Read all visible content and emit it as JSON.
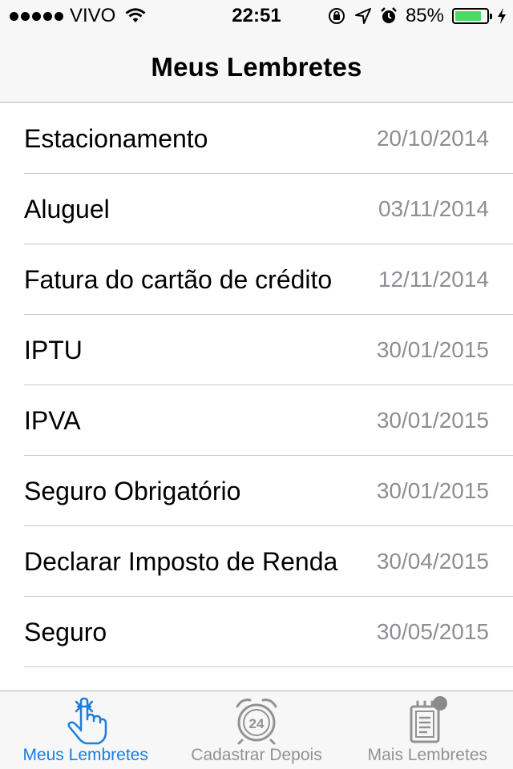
{
  "status_bar": {
    "carrier": "VIVO",
    "time": "22:51",
    "battery_percent": "85%",
    "battery_level": 0.85,
    "battery_color": "#4cd964"
  },
  "nav": {
    "title": "Meus Lembretes"
  },
  "reminders": [
    {
      "title": "Estacionamento",
      "date": "20/10/2014"
    },
    {
      "title": "Aluguel",
      "date": "03/11/2014"
    },
    {
      "title": "Fatura do cartão de crédito",
      "date": "12/11/2014"
    },
    {
      "title": "IPTU",
      "date": "30/01/2015"
    },
    {
      "title": "IPVA",
      "date": "30/01/2015"
    },
    {
      "title": "Seguro Obrigatório",
      "date": "30/01/2015"
    },
    {
      "title": "Declarar Imposto de Renda",
      "date": "30/04/2015"
    },
    {
      "title": "Seguro",
      "date": "30/05/2015"
    }
  ],
  "tabs": [
    {
      "label": "Meus Lembretes",
      "icon": "finger-ribbon-icon",
      "active": true
    },
    {
      "label": "Cadastrar Depois",
      "icon": "alarm-24-icon",
      "active": false
    },
    {
      "label": "Mais Lembretes",
      "icon": "clipboard-icon",
      "active": false
    }
  ],
  "colors": {
    "accent": "#1b7ee0",
    "inactive": "#929292",
    "date": "#8e8e93"
  }
}
